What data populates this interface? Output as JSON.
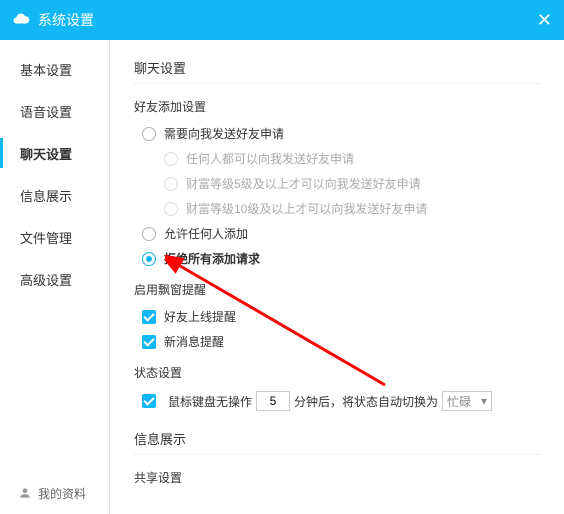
{
  "title": "系统设置",
  "sidebar": [
    "基本设置",
    "语音设置",
    "聊天设置",
    "信息展示",
    "文件管理",
    "高级设置"
  ],
  "sidebar_active": 2,
  "profile": "我的资料",
  "section_chat": "聊天设置",
  "friend_add": {
    "title": "好友添加设置",
    "o1": "需要向我发送好友申请",
    "s1": "任何人都可以向我发送好友申请",
    "s2": "财富等级5级及以上才可以向我发送好友申请",
    "s3": "财富等级10级及以上才可以向我发送好友申请",
    "o2": "允许任何人添加",
    "o3": "拒绝所有添加请求"
  },
  "popup": {
    "title": "启用飘窗提醒",
    "c1": "好友上线提醒",
    "c2": "新消息提醒"
  },
  "status": {
    "title": "状态设置",
    "prefix": "鼠标键盘无操作",
    "minutes": "5",
    "mid": "分钟后，将状态自动切换为",
    "value": "忙碌"
  },
  "section_info": "信息展示",
  "section_share": "共享设置"
}
